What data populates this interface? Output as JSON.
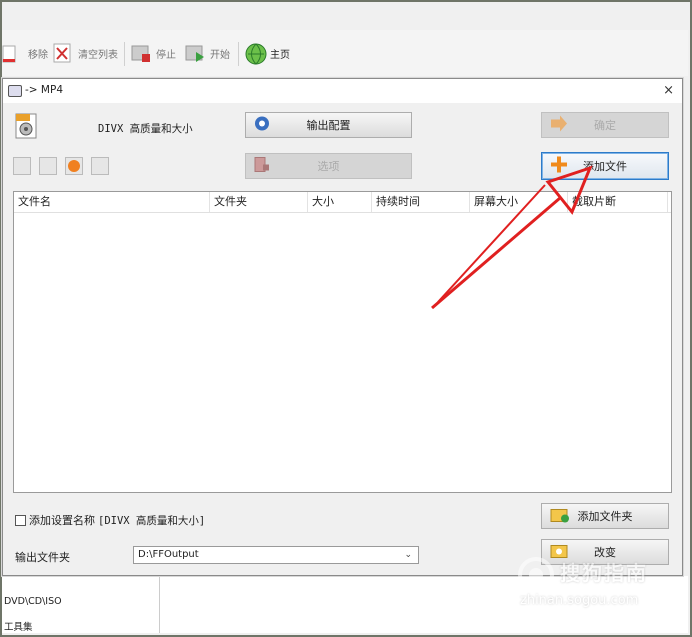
{
  "toolbar": {
    "remove": "移除",
    "clear_list": "清空列表",
    "stop": "停止",
    "start": "开始",
    "home": "主页"
  },
  "background": {
    "sidebar": [
      "DVD\\CD\\ISO",
      "工具集"
    ]
  },
  "dialog": {
    "title": "-> MP4",
    "close": "×",
    "profile_label": "DIVX 高质量和大小",
    "output_config": "输出配置",
    "ok": "确定",
    "options": "选项",
    "add_file": "添加文件",
    "columns": [
      "文件名",
      "文件夹",
      "大小",
      "持续时间",
      "屏幕大小",
      "截取片断"
    ],
    "add_setting_label": "添加设置名称",
    "add_setting_value": "[DIVX 高质量和大小]",
    "add_folder": "添加文件夹",
    "output_folder_label": "输出文件夹",
    "output_folder_value": "D:\\FFOutput",
    "change": "改变"
  },
  "colors": {
    "annotation_arrow": "#e02020",
    "focus_border": "#2d7bc9"
  },
  "watermark": {
    "brand": "搜狗指南",
    "url": "zhinan.sogou.com"
  }
}
